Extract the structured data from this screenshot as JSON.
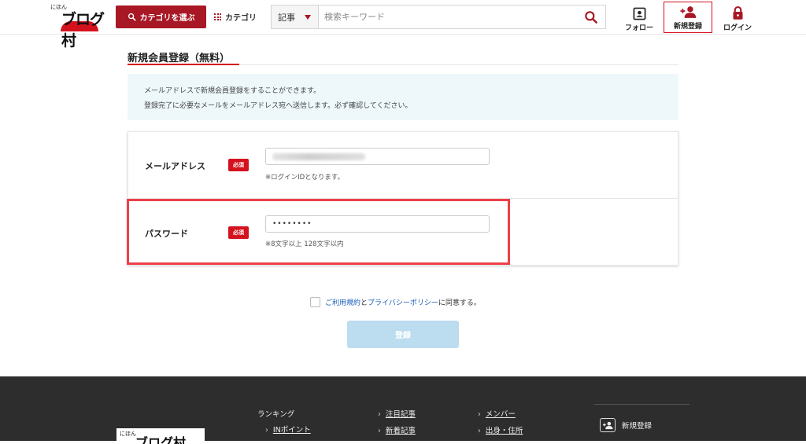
{
  "header": {
    "logo_small": "にほん",
    "logo_big": "ブログ村",
    "category_button": "カテゴリを選ぶ",
    "category_link": "カテゴリ",
    "search_type": "記事",
    "search_placeholder": "検索キーワード",
    "follow_label": "フォロー",
    "signup_label": "新規登録",
    "login_label": "ログイン"
  },
  "main": {
    "title": "新規会員登録（無料）",
    "info_line1": "メールアドレスで新規会員登録をすることができます。",
    "info_line2": "登録完了に必要なメールをメールアドレス宛へ送信します。必ず確認してください。",
    "email": {
      "label": "メールアドレス",
      "required": "必須",
      "note": "※ログインIDとなります。"
    },
    "password": {
      "label": "パスワード",
      "required": "必須",
      "value": "••••••••",
      "note": "※8文字以上 128文字以内"
    },
    "agree": {
      "terms_link": "ご利用規約",
      "and": "と",
      "privacy_link": "プライバシーポリシー",
      "suffix": "に同意する。"
    },
    "submit_label": "登録"
  },
  "footer": {
    "logo_small": "にほん",
    "logo_big": "ブログ村",
    "ranking_head": "ランキング",
    "in_point": "INポイント",
    "featured_articles": "注目記事",
    "new_articles": "新着記事",
    "members": "メンバー",
    "hometown": "出身・住所",
    "signup": "新規登録"
  },
  "colors": {
    "brand_red": "#a81724",
    "accent_red": "#d4121e",
    "highlight": "#ee3f48",
    "link_blue": "#1a5bb8",
    "submit_disabled": "#bcdcef"
  }
}
